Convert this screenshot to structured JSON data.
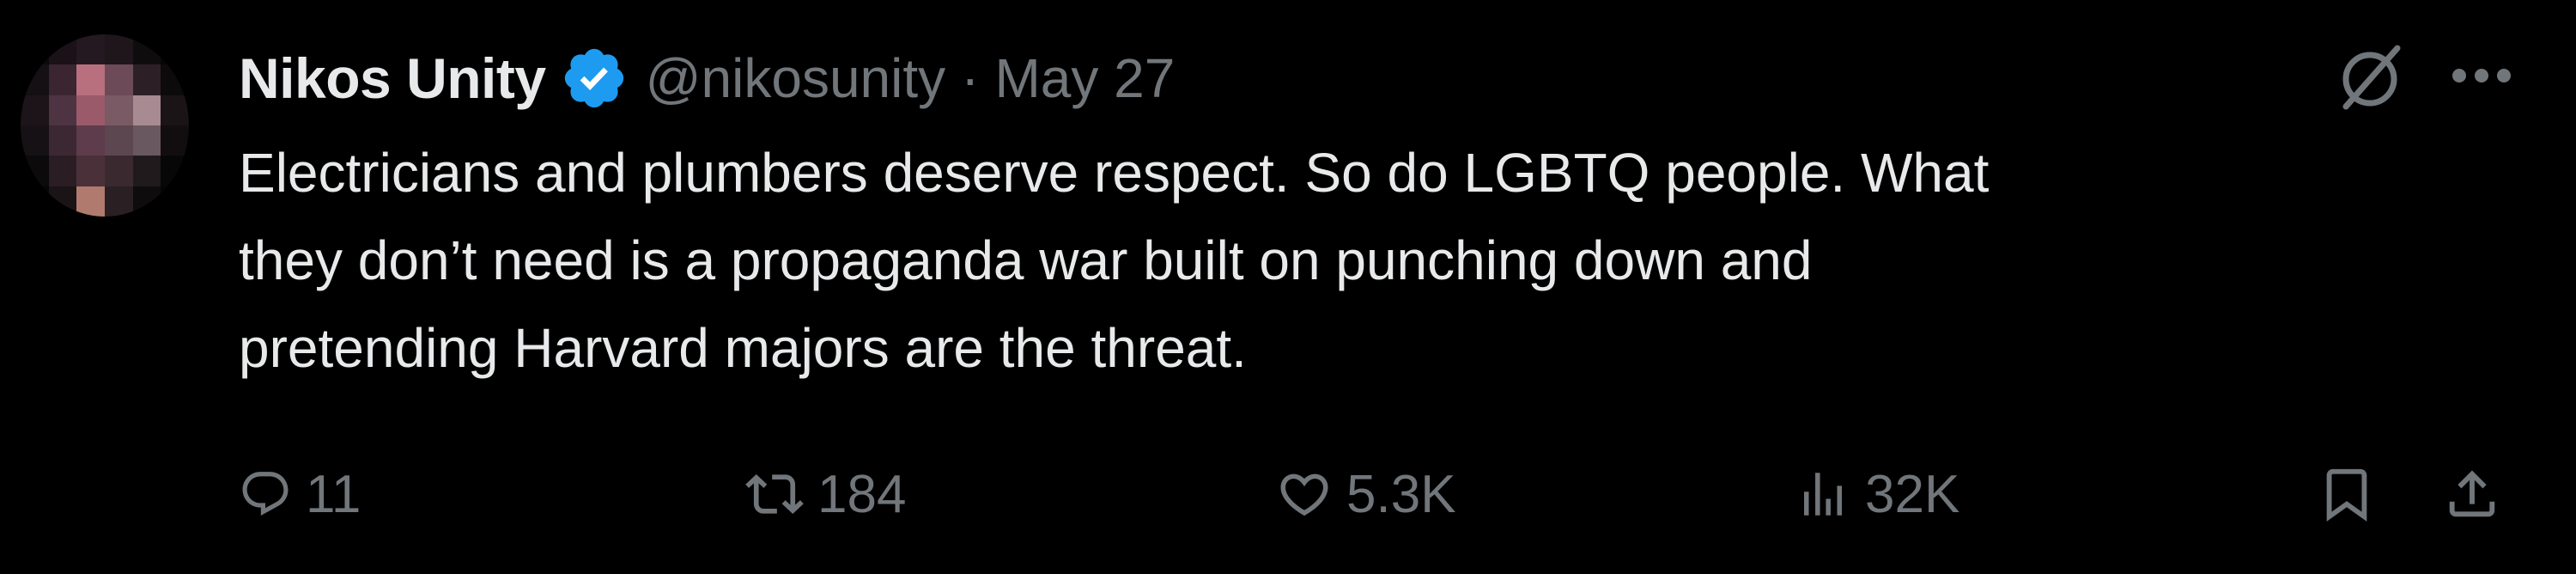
{
  "author": {
    "display_name": "Nikos Unity",
    "handle": "@nikosunity",
    "separator": "·",
    "date": "May 27",
    "verified": true,
    "avatar_icon": "blurred-avatar-image"
  },
  "tweet": {
    "lines": [
      "Electricians and plumbers deserve respect. So do LGBTQ people. What",
      "they don’t need is a propaganda war built on punching down and",
      "pretending Harvard majors are the threat."
    ]
  },
  "header_actions": {
    "grok_icon": "grok-icon",
    "more_icon": "more-icon"
  },
  "metrics": {
    "replies": "11",
    "retweets": "184",
    "likes": "5.3K",
    "views": "32K"
  },
  "colors": {
    "background": "#000000",
    "text_primary": "#e7e9ea",
    "text_secondary": "#71767b",
    "verified_blue": "#1d9bf0"
  }
}
